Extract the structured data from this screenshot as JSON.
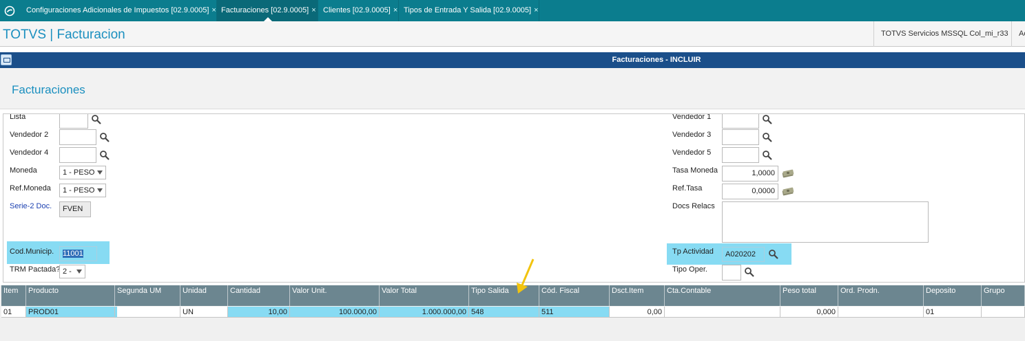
{
  "tabs": [
    {
      "label": "Configuraciones Adicionales de Impuestos [02.9.0005]",
      "active": false
    },
    {
      "label": "Facturaciones [02.9.0005]",
      "active": true
    },
    {
      "label": "Clientes [02.9.0005]",
      "active": false
    },
    {
      "label": "Tipos de Entrada Y Salida [02.9.0005]",
      "active": false
    }
  ],
  "tab_close": "×",
  "app": {
    "title": "TOTVS | Facturacion",
    "environment": "TOTVS Servicios MSSQL Col_mi_r33",
    "extra": "Ac"
  },
  "window": {
    "title": "Facturaciones - INCLUIR"
  },
  "form": {
    "title": "Facturaciones",
    "lista_label": "Lista",
    "lista_value": "",
    "vendedor2_label": "Vendedor 2",
    "vendedor2_value": "",
    "vendedor4_label": "Vendedor 4",
    "vendedor4_value": "",
    "moneda_label": "Moneda",
    "moneda_value": "1 - PESO",
    "refmoneda_label": "Ref.Moneda",
    "refmoneda_value": "1 - PESO",
    "serie_label": "Serie-2 Doc.",
    "serie_value": "FVEN",
    "codmunicip_label": "Cod.Municip.",
    "codmunicip_value": "11001",
    "trm_label": "TRM Pactada?",
    "trm_value": "2 -",
    "vendedor1_label": "Vendedor 1",
    "vendedor1_value": "",
    "vendedor3_label": "Vendedor 3",
    "vendedor3_value": "",
    "vendedor5_label": "Vendedor 5",
    "vendedor5_value": "",
    "tasamoneda_label": "Tasa Moneda",
    "tasamoneda_value": "1,0000",
    "reftasa_label": "Ref.Tasa",
    "reftasa_value": "0,0000",
    "docsrelacs_label": "Docs Relacs",
    "docsrelacs_value": "",
    "tpactividad_label": "Tp Actividad",
    "tpactividad_value": "A020202",
    "tipooper_label": "Tipo Oper.",
    "tipooper_value": ""
  },
  "grid": {
    "columns": [
      "Item",
      "Producto",
      "Segunda UM",
      "Unidad",
      "Cantidad",
      "Valor Unit.",
      "Valor Total",
      "Tipo Salida",
      "Cód. Fiscal",
      "Dsct.Item",
      "Cta.Contable",
      "Peso total",
      "Ord. Prodn.",
      "Deposito",
      "Grupo"
    ],
    "rows": [
      [
        "01",
        "PROD01",
        "",
        "UN",
        "10,00",
        "100.000,00",
        "1.000.000,00",
        "548",
        "511",
        "0,00",
        "",
        "0,000",
        "",
        "01",
        ""
      ]
    ]
  },
  "colors": {
    "tabbar": "#0b7d8e",
    "window_titlebar": "#1b4f8a",
    "highlight": "#87dbf3",
    "grid_header": "#6c8690",
    "annotation_arrow": "#f2c40f"
  },
  "icons": [
    "search-icon",
    "money-icon",
    "close-icon",
    "totvs-logo-icon",
    "window-icon",
    "dropdown-arrow-icon"
  ]
}
